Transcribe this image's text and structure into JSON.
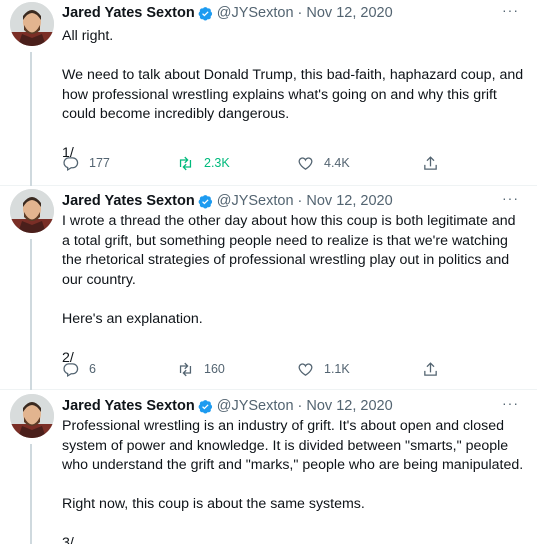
{
  "tweets": [
    {
      "author_name": "Jared Yates Sexton",
      "handle": "@JYSexton",
      "separator": "·",
      "date": "Nov 12, 2020",
      "more": "···",
      "paragraphs": [
        "All right.",
        "We need to talk about Donald Trump, this bad-faith, haphazard coup, and how professional wrestling explains what's going on and why this grift could become incredibly dangerous.",
        "1/"
      ],
      "replies": "177",
      "retweets": "2.3K",
      "likes": "4.4K",
      "retweeted": true
    },
    {
      "author_name": "Jared Yates Sexton",
      "handle": "@JYSexton",
      "separator": "·",
      "date": "Nov 12, 2020",
      "more": "···",
      "paragraphs": [
        "I wrote a thread the other day about how this coup is both legitimate and a total grift, but something people need to realize is that we're watching the rhetorical strategies of professional wrestling play out in politics and our country.",
        "Here's an explanation.",
        "2/"
      ],
      "replies": "6",
      "retweets": "160",
      "likes": "1.1K",
      "retweeted": false
    },
    {
      "author_name": "Jared Yates Sexton",
      "handle": "@JYSexton",
      "separator": "·",
      "date": "Nov 12, 2020",
      "more": "···",
      "paragraphs": [
        "Professional wrestling is an industry of grift. It's about open and closed system of power and knowledge. It is divided between \"smarts,\" people who understand the grift and \"marks,\" people who are being manipulated.",
        "Right now, this coup is about the same systems.",
        "3/"
      ]
    }
  ],
  "colors": {
    "text": "#0f1419",
    "secondary": "#536471",
    "verified_blue": "#1d9bf0",
    "retweet_green": "#00ba7c",
    "divider": "#eff3f4"
  },
  "icons": {
    "verified": "verified-badge-icon",
    "reply": "reply-icon",
    "retweet": "retweet-icon",
    "like": "heart-icon",
    "share": "share-icon",
    "more": "more-icon"
  }
}
